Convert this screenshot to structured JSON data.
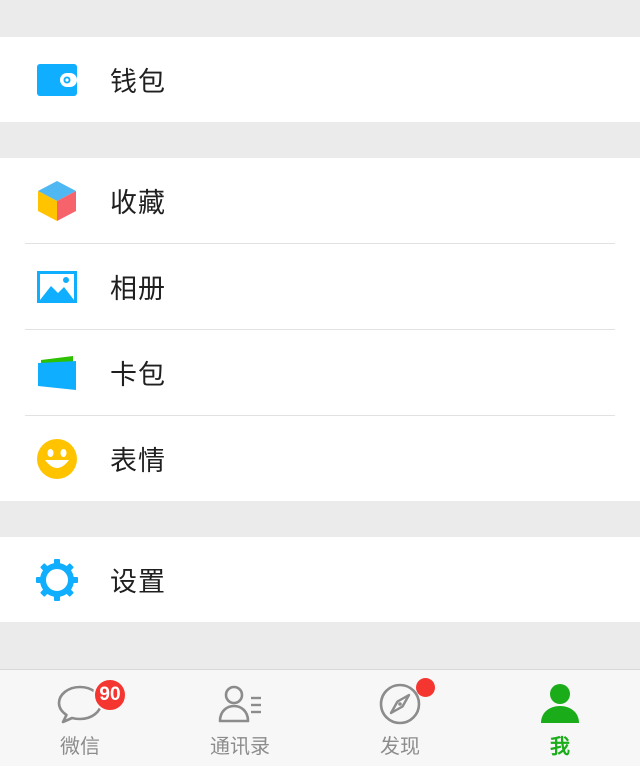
{
  "groups": [
    {
      "items": [
        {
          "label": "钱包",
          "icon": "wallet-icon"
        }
      ]
    },
    {
      "items": [
        {
          "label": "收藏",
          "icon": "favorites-cube-icon"
        },
        {
          "label": "相册",
          "icon": "album-picture-icon"
        },
        {
          "label": "卡包",
          "icon": "card-package-icon"
        },
        {
          "label": "表情",
          "icon": "smiley-icon"
        }
      ]
    },
    {
      "items": [
        {
          "label": "设置",
          "icon": "gear-icon"
        }
      ]
    }
  ],
  "tabbar": {
    "tabs": [
      {
        "label": "微信",
        "icon": "chat-bubble-icon",
        "badge": "90"
      },
      {
        "label": "通讯录",
        "icon": "contacts-icon"
      },
      {
        "label": "发现",
        "icon": "compass-icon",
        "dot": true
      },
      {
        "label": "我",
        "icon": "person-icon",
        "active": true
      }
    ]
  },
  "colors": {
    "accent_green": "#1aad19",
    "badge_red": "#f43530",
    "icon_blue": "#10aeff",
    "background_gray": "#ebebeb"
  }
}
